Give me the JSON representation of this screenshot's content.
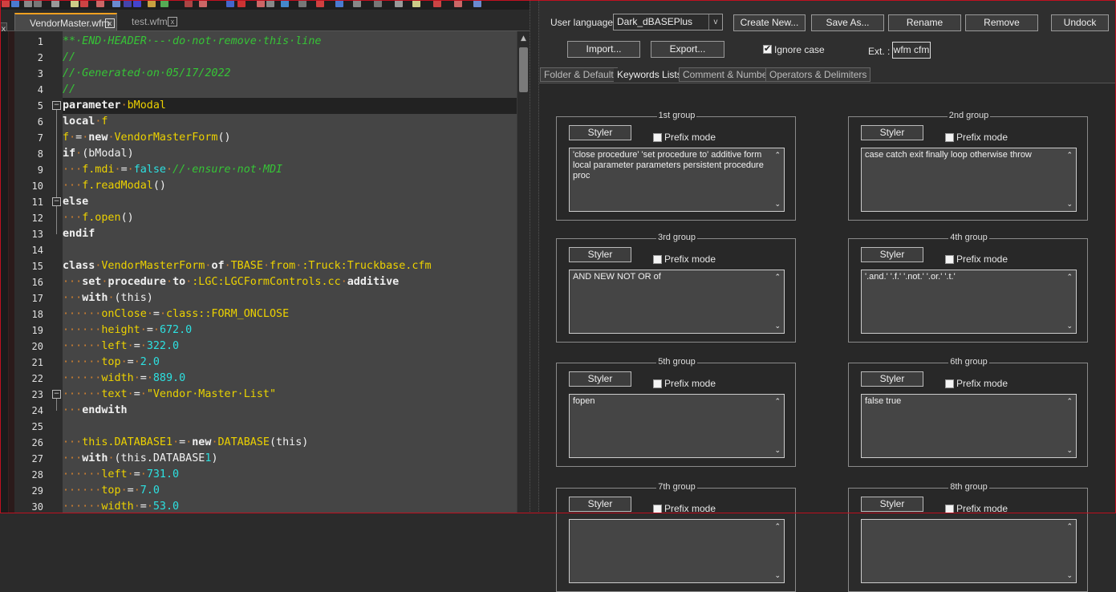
{
  "editor": {
    "tabs": [
      {
        "label": "VendorMaster.wfm",
        "active": true
      },
      {
        "label": "test.wfm",
        "active": false
      }
    ],
    "left_close": "x",
    "close_glyph": "x",
    "lines": [
      {
        "n": "1",
        "tokens": [
          [
            "c",
            "**·END·HEADER·--·do·not·remove·this·line"
          ]
        ]
      },
      {
        "n": "2",
        "tokens": [
          [
            "c",
            "//"
          ]
        ]
      },
      {
        "n": "3",
        "tokens": [
          [
            "c",
            "//·Generated·on·05/17/2022"
          ]
        ]
      },
      {
        "n": "4",
        "tokens": [
          [
            "c",
            "//"
          ]
        ]
      },
      {
        "n": "5",
        "tokens": [
          [
            "k",
            "parameter"
          ],
          [
            "d",
            "·"
          ],
          [
            "i",
            "bModal"
          ]
        ],
        "current": true
      },
      {
        "n": "6",
        "tokens": [
          [
            "k",
            "local"
          ],
          [
            "d",
            "·"
          ],
          [
            "i",
            "f"
          ]
        ]
      },
      {
        "n": "7",
        "tokens": [
          [
            "i",
            "f"
          ],
          [
            "d",
            "·"
          ],
          [
            "o",
            "="
          ],
          [
            "d",
            "·"
          ],
          [
            "k",
            "new"
          ],
          [
            "d",
            "·"
          ],
          [
            "i",
            "VendorMasterForm"
          ],
          [
            "p",
            "()"
          ]
        ]
      },
      {
        "n": "8",
        "tokens": [
          [
            "k",
            "if"
          ],
          [
            "d",
            "·"
          ],
          [
            "p",
            "(bModal)"
          ]
        ]
      },
      {
        "n": "9",
        "tokens": [
          [
            "d",
            "···"
          ],
          [
            "i",
            "f.mdi"
          ],
          [
            "d",
            "·"
          ],
          [
            "o",
            "="
          ],
          [
            "d",
            "·"
          ],
          [
            "n",
            "false"
          ],
          [
            "d",
            "·"
          ],
          [
            "c",
            "//·ensure·not·MDI"
          ]
        ]
      },
      {
        "n": "10",
        "tokens": [
          [
            "d",
            "···"
          ],
          [
            "i",
            "f.readModal"
          ],
          [
            "p",
            "()"
          ]
        ]
      },
      {
        "n": "11",
        "tokens": [
          [
            "k",
            "else"
          ]
        ]
      },
      {
        "n": "12",
        "tokens": [
          [
            "d",
            "···"
          ],
          [
            "i",
            "f.open"
          ],
          [
            "p",
            "()"
          ]
        ]
      },
      {
        "n": "13",
        "tokens": [
          [
            "k",
            "endif"
          ]
        ]
      },
      {
        "n": "14",
        "tokens": []
      },
      {
        "n": "15",
        "tokens": [
          [
            "k",
            "class"
          ],
          [
            "d",
            "·"
          ],
          [
            "i",
            "VendorMasterForm"
          ],
          [
            "d",
            "·"
          ],
          [
            "k",
            "of"
          ],
          [
            "d",
            "·"
          ],
          [
            "i",
            "TBASE"
          ],
          [
            "d",
            "·"
          ],
          [
            "i",
            "from"
          ],
          [
            "d",
            "·"
          ],
          [
            "i",
            ":Truck:Truckbase.cfm"
          ]
        ]
      },
      {
        "n": "16",
        "tokens": [
          [
            "d",
            "···"
          ],
          [
            "k",
            "set"
          ],
          [
            "d",
            "·"
          ],
          [
            "k",
            "procedure"
          ],
          [
            "d",
            "·"
          ],
          [
            "k",
            "to"
          ],
          [
            "d",
            "·"
          ],
          [
            "i",
            ":LGC:LGCFormControls.cc"
          ],
          [
            "d",
            "·"
          ],
          [
            "k",
            "additive"
          ]
        ]
      },
      {
        "n": "17",
        "tokens": [
          [
            "d",
            "···"
          ],
          [
            "k",
            "with"
          ],
          [
            "d",
            "·"
          ],
          [
            "p",
            "(this)"
          ]
        ]
      },
      {
        "n": "18",
        "tokens": [
          [
            "d",
            "······"
          ],
          [
            "i",
            "onClose"
          ],
          [
            "d",
            "·"
          ],
          [
            "o",
            "="
          ],
          [
            "d",
            "·"
          ],
          [
            "i",
            "class::FORM_ONCLOSE"
          ]
        ]
      },
      {
        "n": "19",
        "tokens": [
          [
            "d",
            "······"
          ],
          [
            "i",
            "height"
          ],
          [
            "d",
            "·"
          ],
          [
            "o",
            "="
          ],
          [
            "d",
            "·"
          ],
          [
            "n",
            "672.0"
          ]
        ]
      },
      {
        "n": "20",
        "tokens": [
          [
            "d",
            "······"
          ],
          [
            "i",
            "left"
          ],
          [
            "d",
            "·"
          ],
          [
            "o",
            "="
          ],
          [
            "d",
            "·"
          ],
          [
            "n",
            "322.0"
          ]
        ]
      },
      {
        "n": "21",
        "tokens": [
          [
            "d",
            "······"
          ],
          [
            "i",
            "top"
          ],
          [
            "d",
            "·"
          ],
          [
            "o",
            "="
          ],
          [
            "d",
            "·"
          ],
          [
            "n",
            "2.0"
          ]
        ]
      },
      {
        "n": "22",
        "tokens": [
          [
            "d",
            "······"
          ],
          [
            "i",
            "width"
          ],
          [
            "d",
            "·"
          ],
          [
            "o",
            "="
          ],
          [
            "d",
            "·"
          ],
          [
            "n",
            "889.0"
          ]
        ]
      },
      {
        "n": "23",
        "tokens": [
          [
            "d",
            "······"
          ],
          [
            "i",
            "text"
          ],
          [
            "d",
            "·"
          ],
          [
            "o",
            "="
          ],
          [
            "d",
            "·"
          ],
          [
            "s",
            "\"Vendor·Master·List\""
          ]
        ]
      },
      {
        "n": "24",
        "tokens": [
          [
            "d",
            "···"
          ],
          [
            "k",
            "endwith"
          ]
        ]
      },
      {
        "n": "25",
        "tokens": []
      },
      {
        "n": "26",
        "tokens": [
          [
            "d",
            "···"
          ],
          [
            "i",
            "this.DATABASE1"
          ],
          [
            "d",
            "·"
          ],
          [
            "o",
            "="
          ],
          [
            "d",
            "·"
          ],
          [
            "k",
            "new"
          ],
          [
            "d",
            "·"
          ],
          [
            "i",
            "DATABASE"
          ],
          [
            "p",
            "(this)"
          ]
        ]
      },
      {
        "n": "27",
        "tokens": [
          [
            "d",
            "···"
          ],
          [
            "k",
            "with"
          ],
          [
            "d",
            "·"
          ],
          [
            "p",
            "(this.DATABASE"
          ],
          [
            "n",
            "1"
          ],
          [
            "p",
            ")"
          ]
        ]
      },
      {
        "n": "28",
        "tokens": [
          [
            "d",
            "······"
          ],
          [
            "i",
            "left"
          ],
          [
            "d",
            "·"
          ],
          [
            "o",
            "="
          ],
          [
            "d",
            "·"
          ],
          [
            "n",
            "731.0"
          ]
        ]
      },
      {
        "n": "29",
        "tokens": [
          [
            "d",
            "······"
          ],
          [
            "i",
            "top"
          ],
          [
            "d",
            "·"
          ],
          [
            "o",
            "="
          ],
          [
            "d",
            "·"
          ],
          [
            "n",
            "7.0"
          ]
        ]
      },
      {
        "n": "30",
        "tokens": [
          [
            "d",
            "······"
          ],
          [
            "i",
            "width"
          ],
          [
            "d",
            "·"
          ],
          [
            "o",
            "="
          ],
          [
            "d",
            "·"
          ],
          [
            "n",
            "53.0"
          ]
        ]
      }
    ],
    "folds": [
      {
        "line": 5,
        "glyph": "−"
      },
      {
        "line": 11,
        "glyph": "−"
      },
      {
        "line": 23,
        "glyph": "−"
      }
    ],
    "scroll_up_glyph": "▲"
  },
  "settings": {
    "user_language_label": "User language :",
    "user_language_value": "Dark_dBASEPlus",
    "dropdown_glyph": "v",
    "buttons": {
      "create_new": "Create New...",
      "save_as": "Save As...",
      "rename": "Rename",
      "remove": "Remove",
      "undock": "Undock",
      "import": "Import...",
      "export": "Export..."
    },
    "ignore_case_label": "Ignore case",
    "ignore_case_checked": true,
    "checkmark_glyph": "✔",
    "ext_label": "Ext. :",
    "ext_value": "wfm cfm",
    "tabs": [
      {
        "label": "Folder & Default",
        "selected": false
      },
      {
        "label": "Keywords Lists",
        "selected": true
      },
      {
        "label": "Comment & Number",
        "selected": false
      },
      {
        "label": "Operators & Delimiters",
        "selected": false
      }
    ],
    "styler_label": "Styler",
    "prefix_mode_label": "Prefix mode",
    "scroll_up_glyph": "⌃",
    "scroll_down_glyph": "⌄",
    "groups": [
      {
        "title": "1st group",
        "keywords": "'close procedure' 'set procedure to' additive form local parameter parameters persistent procedure proc"
      },
      {
        "title": "2nd group",
        "keywords": "case catch exit finally loop otherwise throw"
      },
      {
        "title": "3rd group",
        "keywords": "AND NEW NOT OR of"
      },
      {
        "title": "4th group",
        "keywords": "'.and.' '.f.' '.not.' '.or.' '.t.'"
      },
      {
        "title": "5th group",
        "keywords": "fopen"
      },
      {
        "title": "6th group",
        "keywords": "false true"
      },
      {
        "title": "7th group",
        "keywords": ""
      },
      {
        "title": "8th group",
        "keywords": ""
      }
    ]
  },
  "colors": {
    "comment": "#36c436",
    "identifier": "#ecd100",
    "number": "#2de0e0",
    "whitespace_dot": "#d08030",
    "tab_accent": "#f0a020",
    "frame_border": "#c01020"
  }
}
